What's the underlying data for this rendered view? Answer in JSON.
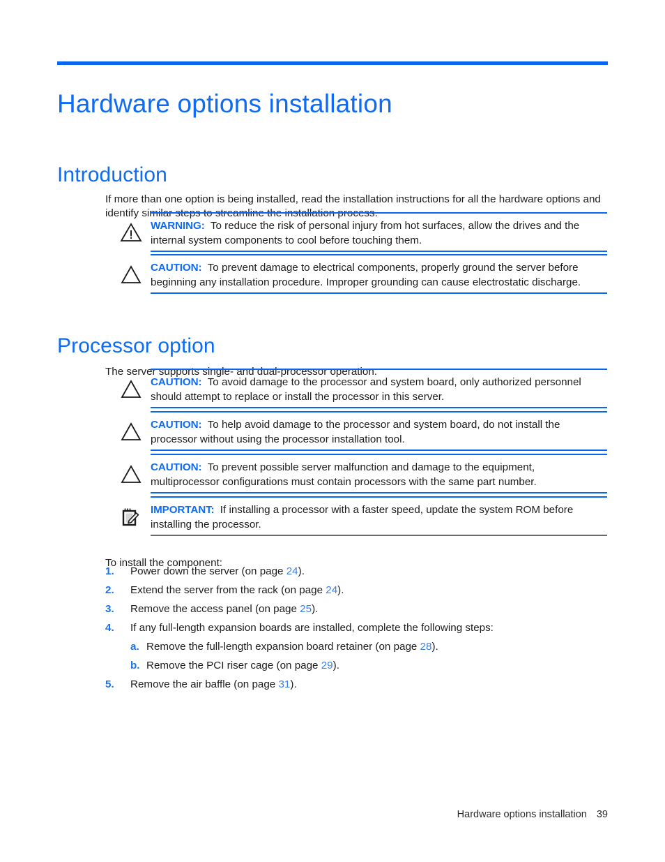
{
  "document": {
    "chapter_title": "Hardware options installation",
    "footer_text": "Hardware options installation",
    "footer_page_number": "39",
    "accent_blue": "#0E6BF5",
    "rule_blue": "#0A66F0",
    "link_blue": "#3B7FE8",
    "body_color": "#1c1c1c"
  },
  "sections": {
    "introduction": {
      "heading": "Introduction",
      "paragraph": "If more than one option is being installed, read the installation instructions for all the hardware options and identify similar steps to streamline the installation process.",
      "alerts": [
        {
          "icon": "warning-triangle-icon",
          "label": "WARNING:",
          "text": "To reduce the risk of personal injury from hot surfaces, allow the drives and the internal system components to cool before touching them."
        },
        {
          "icon": "caution-triangle-icon",
          "label": "CAUTION:",
          "text": "To prevent damage to electrical components, properly ground the server before beginning any installation procedure. Improper grounding can cause electrostatic discharge."
        }
      ]
    },
    "processor_option": {
      "heading": "Processor option",
      "paragraph": "The server supports single- and dual-processor operation.",
      "alerts": [
        {
          "icon": "caution-triangle-icon",
          "label": "CAUTION:",
          "text": "To avoid damage to the processor and system board, only authorized personnel should attempt to replace or install the processor in this server."
        },
        {
          "icon": "caution-triangle-icon",
          "label": "CAUTION:",
          "text": "To help avoid damage to the processor and system board, do not install the processor without using the processor installation tool."
        },
        {
          "icon": "caution-triangle-icon",
          "label": "CAUTION:",
          "text": "To prevent possible server malfunction and damage to the equipment, multiprocessor configurations must contain processors with the same part number."
        },
        {
          "icon": "important-note-icon",
          "label": "IMPORTANT:",
          "text": "If installing a processor with a faster speed, update the system ROM before installing the processor."
        }
      ],
      "install_lead": "To install the component:",
      "steps": [
        {
          "marker": "1.",
          "text_before": "Power down the server (on page ",
          "page": "24",
          "text_after": ")."
        },
        {
          "marker": "2.",
          "text_before": "Extend the server from the rack (on page ",
          "page": "24",
          "text_after": ")."
        },
        {
          "marker": "3.",
          "text_before": "Remove the access panel (on page ",
          "page": "25",
          "text_after": ")."
        },
        {
          "marker": "4.",
          "text_before": "If any full-length expansion boards are installed, complete the following steps:",
          "page": "",
          "text_after": ""
        },
        {
          "marker": "a.",
          "text_before": "Remove the full-length expansion board retainer (on page ",
          "page": "28",
          "text_after": ")."
        },
        {
          "marker": "b.",
          "text_before": "Remove the PCI riser cage (on page ",
          "page": "29",
          "text_after": ")."
        },
        {
          "marker": "5.",
          "text_before": "Remove the air baffle (on page ",
          "page": "31",
          "text_after": ")."
        }
      ]
    }
  }
}
